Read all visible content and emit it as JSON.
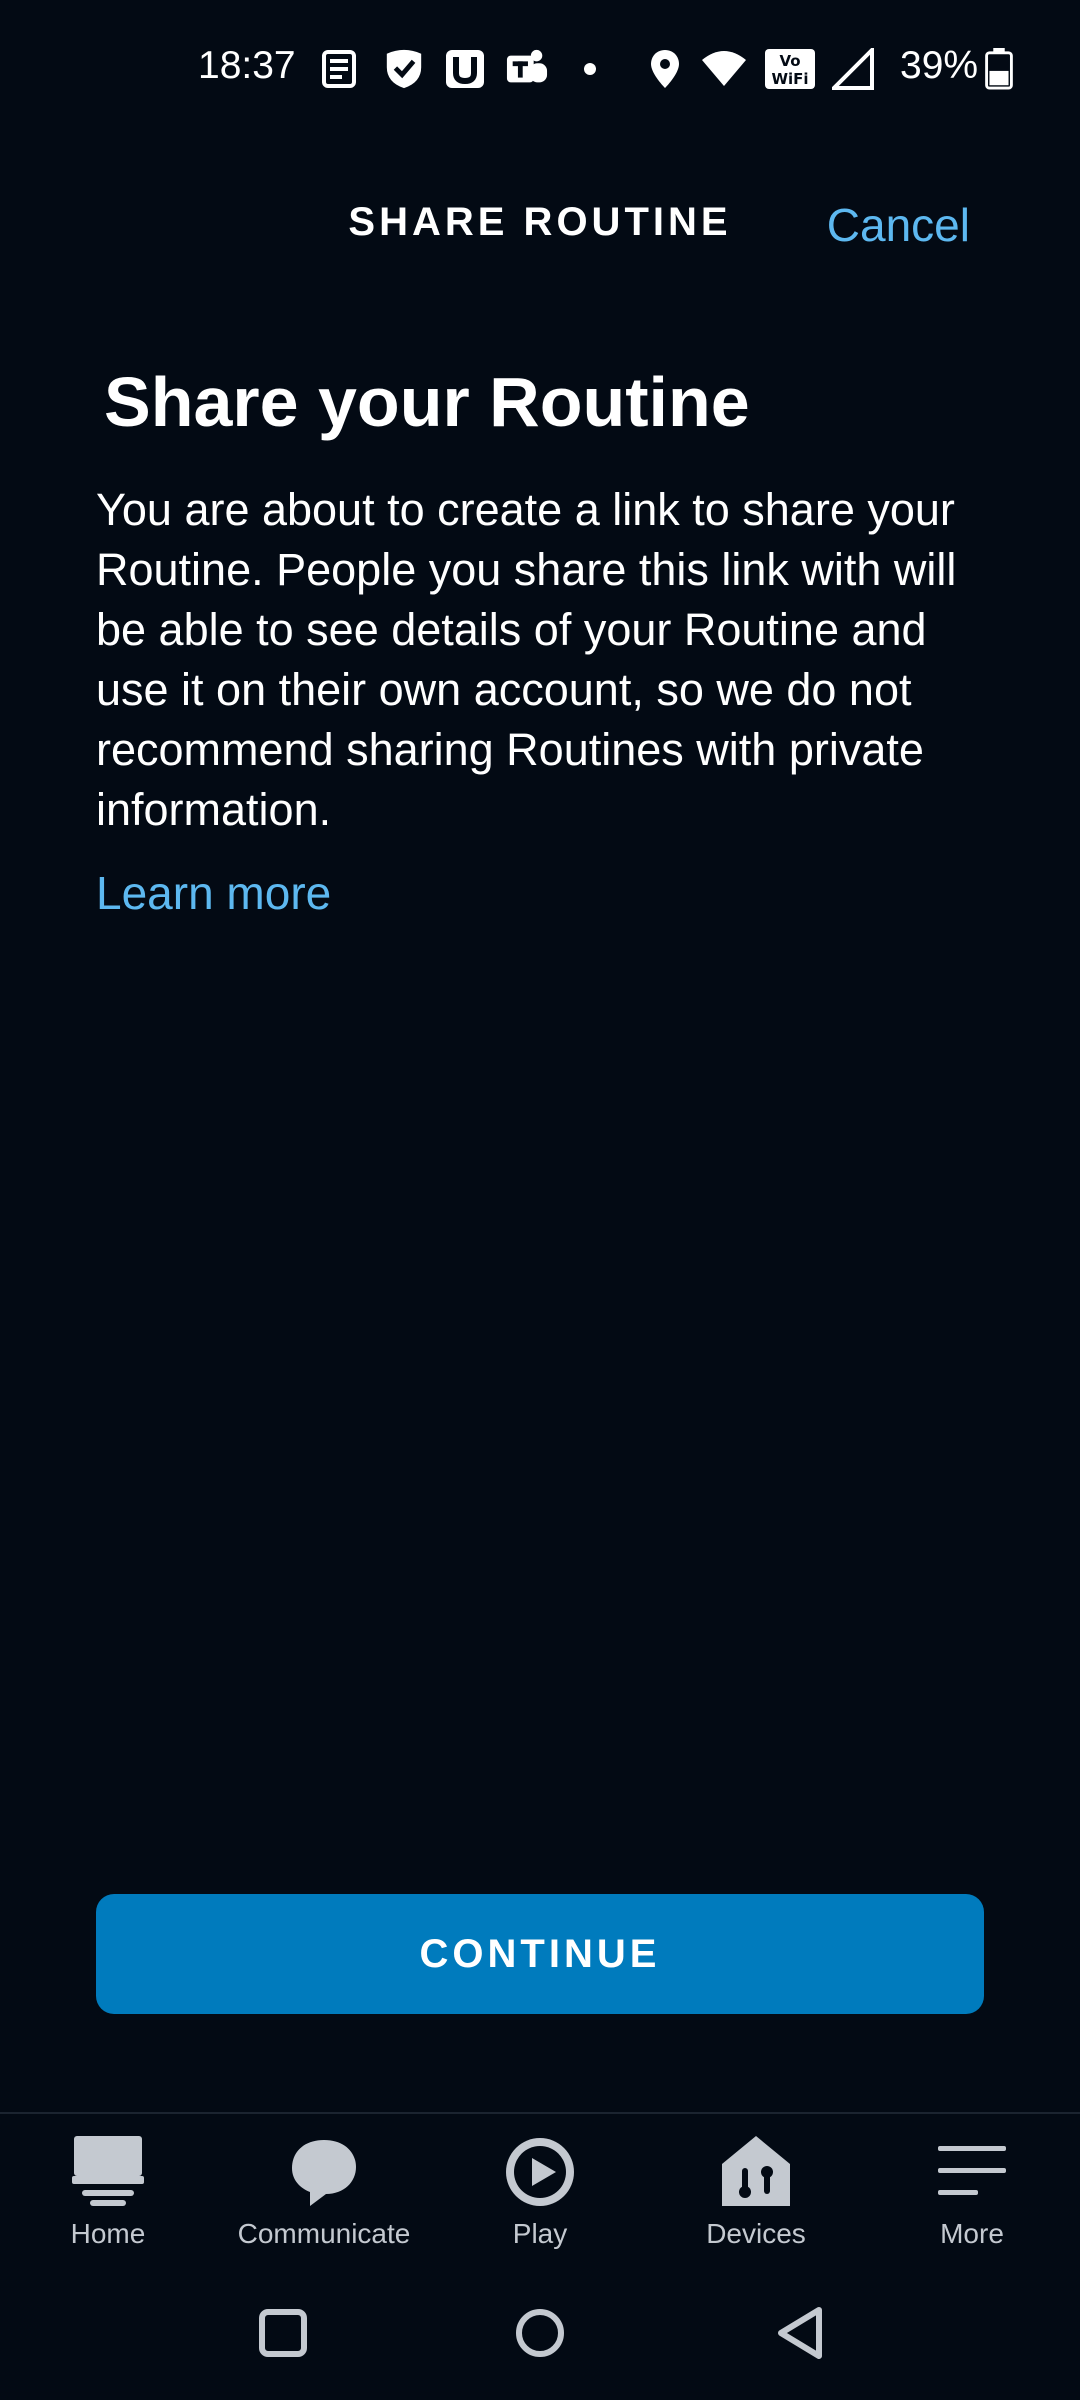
{
  "status_bar": {
    "time": "18:37",
    "battery_percent": "39%",
    "icons": [
      "news-icon",
      "check-shield-icon",
      "u-app-icon",
      "teams-icon",
      "dot-icon",
      "location-icon",
      "wifi-icon",
      "vowifi-icon",
      "signal-icon",
      "battery-icon"
    ],
    "vowifi_top": "Vo",
    "vowifi_bottom": "WiFi"
  },
  "header": {
    "title": "SHARE ROUTINE",
    "cancel_label": "Cancel"
  },
  "content": {
    "title": "Share your Routine",
    "description": "You are about to create a link to share your Routine. People you share this link with will be able to see details of your Routine and use it on their own account, so we do not recommend sharing Routines with private information.",
    "learn_more": "Learn more"
  },
  "actions": {
    "continue_label": "CONTINUE"
  },
  "bottom_nav": {
    "items": [
      {
        "label": "Home",
        "icon": "home-icon"
      },
      {
        "label": "Communicate",
        "icon": "chat-bubble-icon"
      },
      {
        "label": "Play",
        "icon": "play-icon"
      },
      {
        "label": "Devices",
        "icon": "devices-icon"
      },
      {
        "label": "More",
        "icon": "menu-icon"
      }
    ]
  },
  "colors": {
    "background": "#030a14",
    "accent_link": "#5db8f0",
    "primary_button": "#007bbd",
    "nav_icon": "#c4c9d0"
  }
}
